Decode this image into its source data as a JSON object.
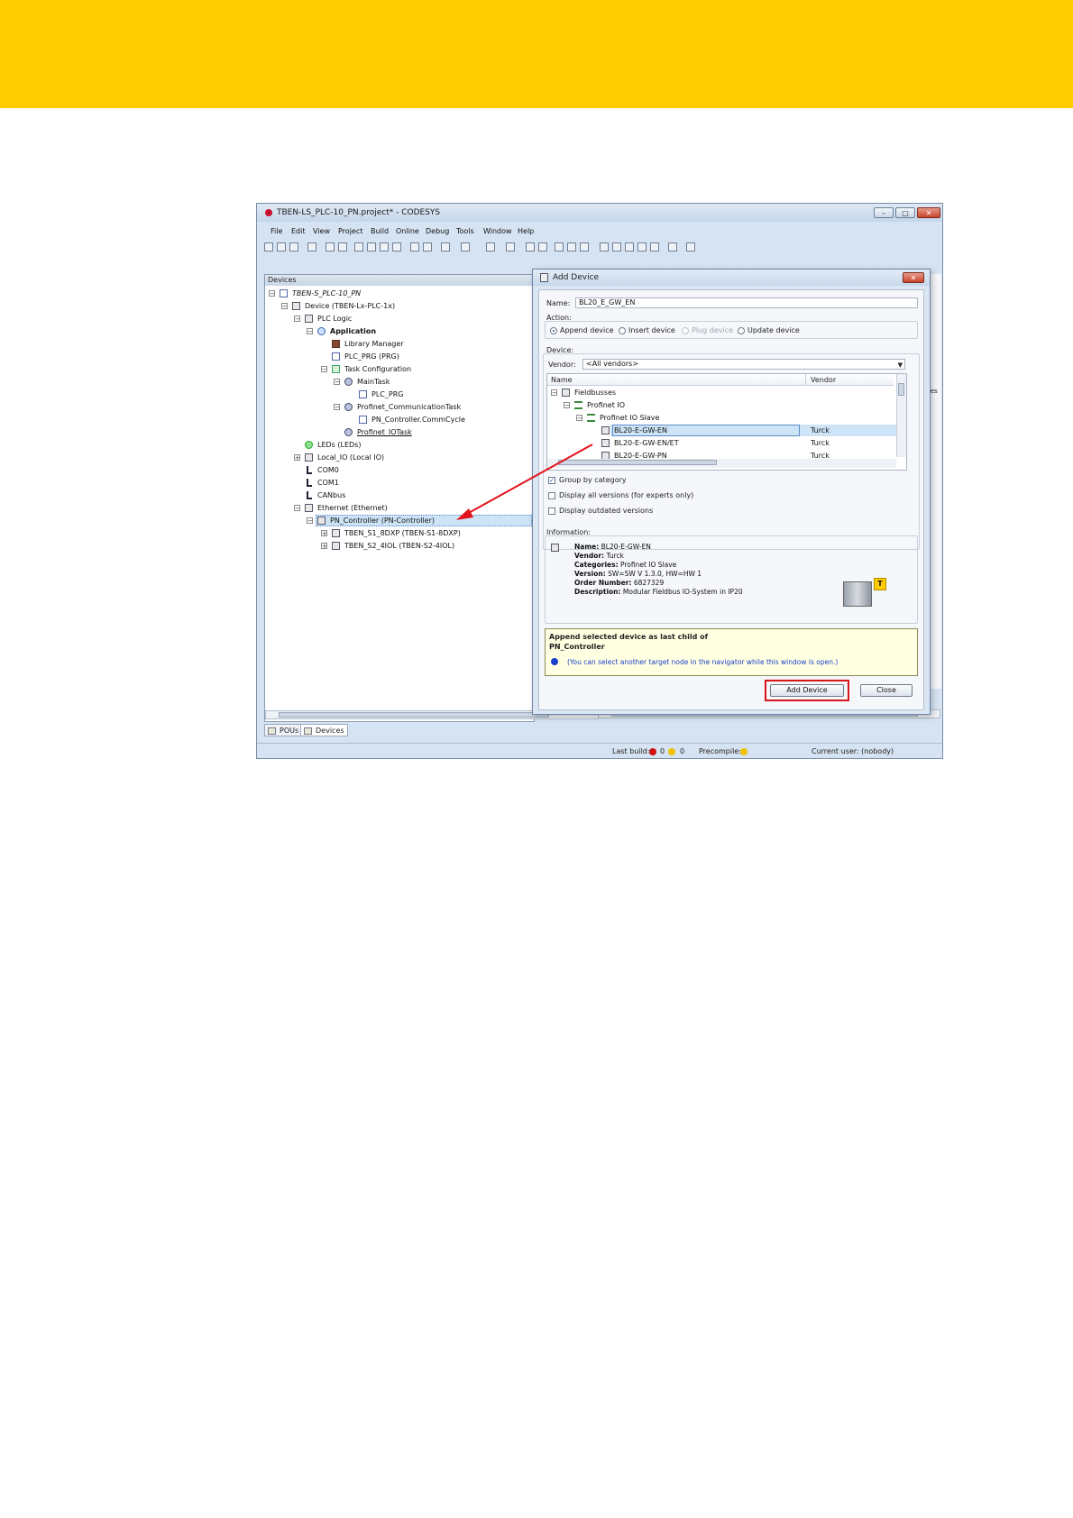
{
  "window": {
    "title": "TBEN-LS_PLC-10_PN.project* - CODESYS",
    "minimize": "–",
    "maximize": "□",
    "close": "✕"
  },
  "menu": [
    "File",
    "Edit",
    "View",
    "Project",
    "Build",
    "Online",
    "Debug",
    "Tools",
    "Window",
    "Help"
  ],
  "devices_panel": {
    "title": "Devices",
    "tree": [
      {
        "label": "TBEN-S_PLC-10_PN",
        "icon": "project-icon"
      },
      {
        "label": "Device (TBEN-Lx-PLC-1x)",
        "icon": "device-icon"
      },
      {
        "label": "PLC Logic",
        "icon": "plc-logic-icon"
      },
      {
        "label": "Application",
        "icon": "application-icon"
      },
      {
        "label": "Library Manager",
        "icon": "library-icon"
      },
      {
        "label": "PLC_PRG (PRG)",
        "icon": "program-icon"
      },
      {
        "label": "Task Configuration",
        "icon": "task-config-icon"
      },
      {
        "label": "MainTask",
        "icon": "task-icon"
      },
      {
        "label": "PLC_PRG",
        "icon": "program-icon"
      },
      {
        "label": "Profinet_CommunicationTask",
        "icon": "task-icon"
      },
      {
        "label": "PN_Controller.CommCycle",
        "icon": "program-icon"
      },
      {
        "label": "Profinet_IOTask",
        "icon": "task-icon"
      },
      {
        "label": "LEDs (LEDs)",
        "icon": "led-icon"
      },
      {
        "label": "Local_IO (Local IO)",
        "icon": "device-icon"
      },
      {
        "label": "COM0",
        "icon": "com-icon"
      },
      {
        "label": "COM1",
        "icon": "com-icon"
      },
      {
        "label": "CANbus",
        "icon": "com-icon"
      },
      {
        "label": "Ethernet (Ethernet)",
        "icon": "device-icon"
      },
      {
        "label": "PN_Controller (PN-Controller)",
        "icon": "device-icon"
      },
      {
        "label": "TBEN_S1_8DXP (TBEN-S1-8DXP)",
        "icon": "io-module-icon"
      },
      {
        "label": "TBEN_S2_4IOL (TBEN-S2-4IOL)",
        "icon": "io-module-icon"
      }
    ]
  },
  "bottom_tabs": [
    "POUs",
    "Devices"
  ],
  "status_bar": {
    "last_build": "Last build:",
    "errors": "0",
    "warnings": "0",
    "precompile": "Precompile:",
    "current_user": "Current user: (nobody)"
  },
  "right_edge_text": "ites",
  "dialog": {
    "title": "Add Device",
    "name_label": "Name:",
    "name_value": "BL20_E_GW_EN",
    "action_label": "Action:",
    "actions": [
      "Append device",
      "Insert device",
      "Plug device",
      "Update device"
    ],
    "selected_action": "Append device",
    "device_label": "Device:",
    "vendor_label": "Vendor:",
    "vendor_value": "<All vendors>",
    "list_headers": [
      "Name",
      "Vendor"
    ],
    "list_rows": [
      {
        "name": "Fieldbusses",
        "vendor": ""
      },
      {
        "name": "Profinet IO",
        "vendor": ""
      },
      {
        "name": "Profinet IO Slave",
        "vendor": ""
      },
      {
        "name": "BL20-E-GW-EN",
        "vendor": "Turck"
      },
      {
        "name": "BL20-E-GW-EN/ET",
        "vendor": "Turck"
      },
      {
        "name": "BL20-E-GW-PN",
        "vendor": "Turck"
      }
    ],
    "options": [
      {
        "label": "Group by category",
        "checked": true
      },
      {
        "label": "Display all versions (for experts only)",
        "checked": false
      },
      {
        "label": "Display outdated versions",
        "checked": false
      }
    ],
    "information_label": "Information:",
    "info": {
      "name_key": "Name:",
      "name_val": "BL20-E-GW-EN",
      "vendor_key": "Vendor:",
      "vendor_val": "Turck",
      "categories_key": "Categories:",
      "categories_val": "Profinet IO Slave",
      "version_key": "Version:",
      "version_val": "SW=SW V 1.3.0, HW=HW 1",
      "order_key": "Order Number:",
      "order_val": "6827329",
      "description_key": "Description:",
      "description_val": "Modular Fieldbus IO-System in IP20"
    },
    "hint_title": "Append selected device as last child of",
    "hint_target": "PN_Controller",
    "hint_note": "(You can select another target node in the navigator while this window is open.)",
    "add_button": "Add Device",
    "close_button": "Close"
  },
  "colors": {
    "banner": "#ffcc00",
    "highlight": "#d9141b",
    "arrow": "#e3131b"
  }
}
